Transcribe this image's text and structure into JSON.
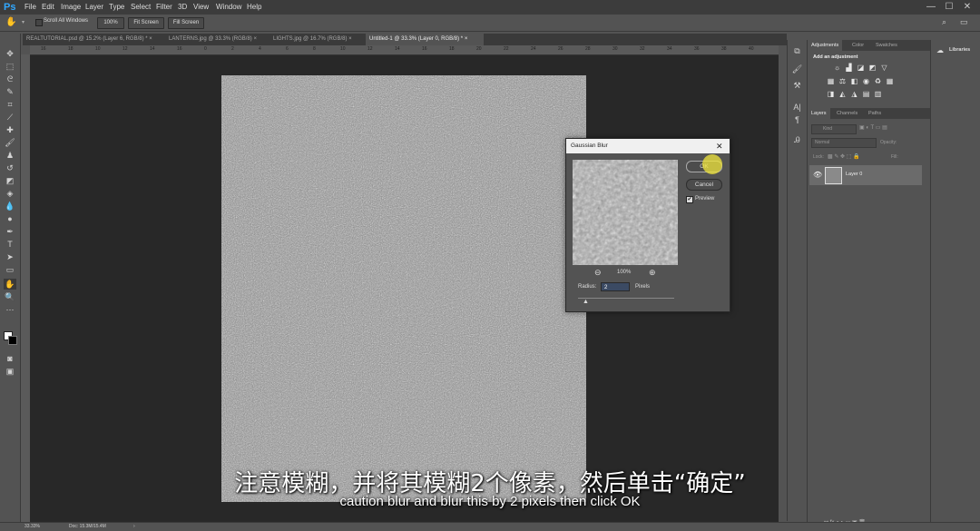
{
  "app": {
    "logo": "Ps",
    "menu": [
      "File",
      "Edit",
      "Image",
      "Layer",
      "Type",
      "Select",
      "Filter",
      "3D",
      "View",
      "Window",
      "Help"
    ],
    "window_controls": [
      "—",
      "☐",
      "✕"
    ]
  },
  "options_bar": {
    "scroll_all_windows": "Scroll All Windows",
    "zoom_button": "100%",
    "fit_screen": "Fit Screen",
    "fill_screen": "Fill Screen"
  },
  "tabs": [
    {
      "label": "REALTUTORIAL.psd @ 15.2% (Layer 6, RGB/8) *",
      "close": "×"
    },
    {
      "label": "LANTERNS.jpg @ 33.3% (RGB/8)",
      "close": "×"
    },
    {
      "label": "LIGHTS.jpg @ 16.7% (RGB/8)",
      "close": "×"
    },
    {
      "label": "Untitled-1 @ 33.3% (Layer 0, RGB/8) *",
      "close": "×"
    }
  ],
  "ruler_ticks": [
    "16",
    "18",
    "10",
    "12",
    "14",
    "16",
    "0",
    "2",
    "4",
    "6",
    "8",
    "10",
    "12",
    "14",
    "16",
    "18",
    "20",
    "22",
    "24",
    "26",
    "28",
    "30",
    "32",
    "34",
    "36",
    "38",
    "40"
  ],
  "status": {
    "zoom": "33.33%",
    "doc": "Doc: 15.3M/15.4M",
    "arrow": "›"
  },
  "dialog": {
    "title": "Gaussian Blur",
    "close": "✕",
    "ok": "OK",
    "cancel": "Cancel",
    "preview_label": "Preview",
    "zoom_out": "⊖",
    "zoom_level": "100%",
    "zoom_in": "⊕",
    "radius_label": "Radius:",
    "radius_value": "2",
    "unit": "Pixels"
  },
  "adjustments_panel": {
    "tabs": [
      "Adjustments",
      "Color",
      "Swatches"
    ],
    "heading": "Add an adjustment"
  },
  "layers_panel": {
    "tabs": [
      "Layers",
      "Channels",
      "Paths"
    ],
    "kind": "Kind",
    "blend_mode": "Normal",
    "opacity_label": "Opacity:",
    "lock_label": "Lock:",
    "fill_label": "Fill:",
    "layer_name": "Layer 0"
  },
  "libraries": {
    "label": "Libraries"
  },
  "subtitles": {
    "chinese": "注意模糊，并将其模糊2个像素，然后单击“确定”",
    "english": "caution blur and blur this by 2 pixels then click OK"
  }
}
